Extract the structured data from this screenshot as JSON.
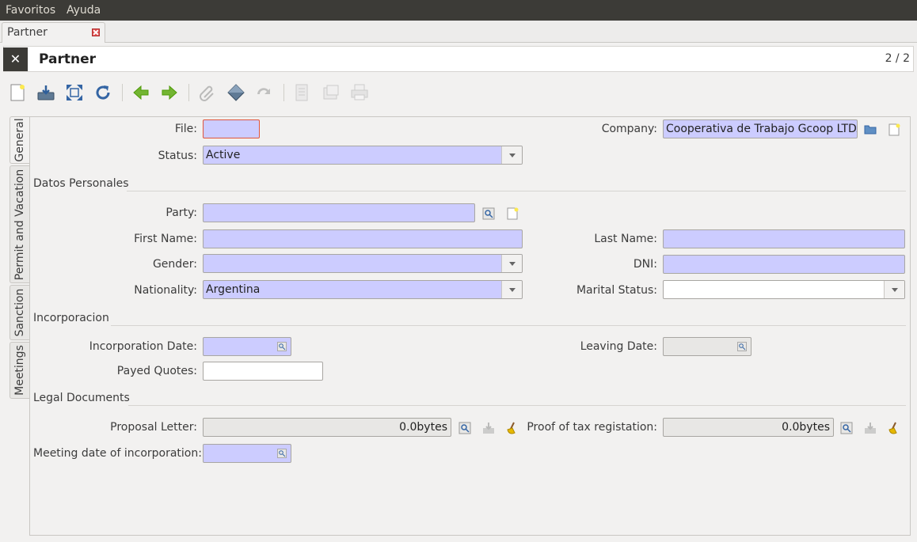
{
  "menubar": {
    "items": [
      "Favoritos",
      "Ayuda"
    ]
  },
  "tabs": [
    {
      "label": "Partner"
    }
  ],
  "header": {
    "title": "Partner",
    "record_count": "2 / 2"
  },
  "toolbar": {
    "buttons": [
      "new-record",
      "save",
      "fullscreen",
      "reload",
      "previous",
      "next",
      "attachment",
      "action",
      "relate",
      "report",
      "email",
      "print"
    ]
  },
  "side_tabs": [
    "General",
    "Permit and Vacation",
    "Sanction",
    "Meetings"
  ],
  "form": {
    "file": {
      "label": "File:",
      "value": ""
    },
    "company": {
      "label": "Company:",
      "value": "Cooperativa de Trabajo Gcoop LTDA"
    },
    "status": {
      "label": "Status:",
      "value": "Active"
    },
    "section_personal": "Datos Personales",
    "party": {
      "label": "Party:",
      "value": ""
    },
    "first_name": {
      "label": "First Name:",
      "value": ""
    },
    "last_name": {
      "label": "Last Name:",
      "value": ""
    },
    "gender": {
      "label": "Gender:",
      "value": ""
    },
    "dni": {
      "label": "DNI:",
      "value": ""
    },
    "nationality": {
      "label": "Nationality:",
      "value": "Argentina"
    },
    "marital_status": {
      "label": "Marital Status:",
      "value": ""
    },
    "section_incorporacion": "Incorporacion",
    "incorporation_date": {
      "label": "Incorporation Date:",
      "value": ""
    },
    "leaving_date": {
      "label": "Leaving Date:",
      "value": ""
    },
    "payed_quotes": {
      "label": "Payed Quotes:",
      "value": ""
    },
    "section_legal": "Legal Documents",
    "proposal_letter": {
      "label": "Proposal Letter:",
      "value": "0.0bytes"
    },
    "proof_tax": {
      "label": "Proof of tax registation:",
      "value": "0.0bytes"
    },
    "meeting_date": {
      "label": "Meeting date of incorporation:",
      "value": ""
    }
  },
  "colors": {
    "required_field": "#ccccff",
    "menubar": "#3c3b37",
    "accent_green": "#4e9a06"
  }
}
